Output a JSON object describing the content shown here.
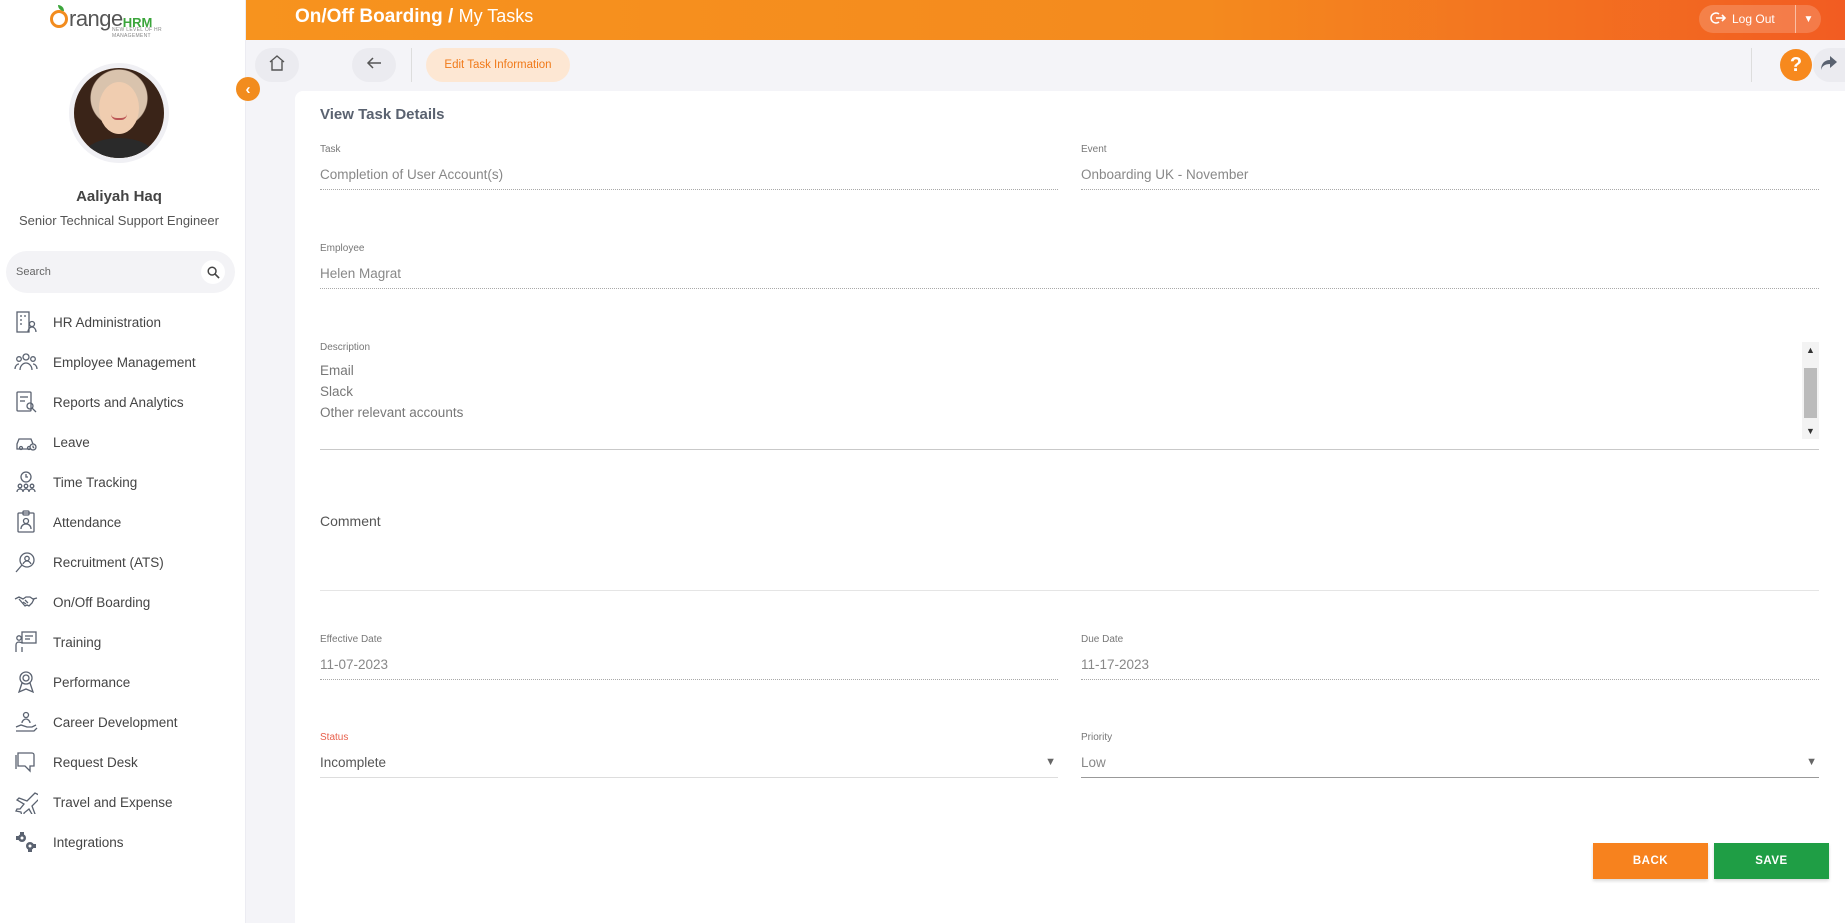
{
  "app": {
    "logo_text": "range",
    "logo_hrm": "HRM",
    "logo_tagline": "NEW LEVEL OF HR MANAGEMENT"
  },
  "user": {
    "name": "Aaliyah Haq",
    "title": "Senior Technical Support Engineer"
  },
  "search": {
    "placeholder": "Search"
  },
  "sidebar": {
    "items": [
      {
        "label": "HR Administration",
        "icon": "building-person-icon"
      },
      {
        "label": "Employee Management",
        "icon": "people-group-icon"
      },
      {
        "label": "Reports and Analytics",
        "icon": "report-search-icon"
      },
      {
        "label": "Leave",
        "icon": "leave-car-icon"
      },
      {
        "label": "Time Tracking",
        "icon": "clock-people-icon"
      },
      {
        "label": "Attendance",
        "icon": "attendance-badge-icon"
      },
      {
        "label": "Recruitment (ATS)",
        "icon": "recruit-search-icon"
      },
      {
        "label": "On/Off Boarding",
        "icon": "handshake-icon"
      },
      {
        "label": "Training",
        "icon": "training-board-icon"
      },
      {
        "label": "Performance",
        "icon": "performance-medal-icon"
      },
      {
        "label": "Career Development",
        "icon": "career-hand-icon"
      },
      {
        "label": "Request Desk",
        "icon": "request-desk-icon"
      },
      {
        "label": "Travel and Expense",
        "icon": "airplane-icon"
      },
      {
        "label": "Integrations",
        "icon": "puzzle-gear-icon"
      }
    ]
  },
  "header": {
    "title": "On/Off Boarding",
    "separator": " / ",
    "subtitle": "My Tasks",
    "logout": "Log Out"
  },
  "toolbar": {
    "chip": "Edit Task Information"
  },
  "form": {
    "title": "View Task Details",
    "task": {
      "label": "Task",
      "value": "Completion of User Account(s)"
    },
    "event": {
      "label": "Event",
      "value": "Onboarding UK - November"
    },
    "employee": {
      "label": "Employee",
      "value": "Helen Magrat"
    },
    "description": {
      "label": "Description",
      "lines": [
        "Email",
        "Slack",
        "Other relevant accounts"
      ]
    },
    "comment": {
      "label": "Comment"
    },
    "effective_date": {
      "label": "Effective Date",
      "value": "11-07-2023"
    },
    "due_date": {
      "label": "Due Date",
      "value": "11-17-2023"
    },
    "status": {
      "label": "Status",
      "value": "Incomplete"
    },
    "priority": {
      "label": "Priority",
      "value": "Low"
    }
  },
  "buttons": {
    "back": "BACK",
    "save": "SAVE"
  },
  "colors": {
    "accent": "#f7931e",
    "save": "#1f9e45",
    "status_label": "#e8604c"
  }
}
